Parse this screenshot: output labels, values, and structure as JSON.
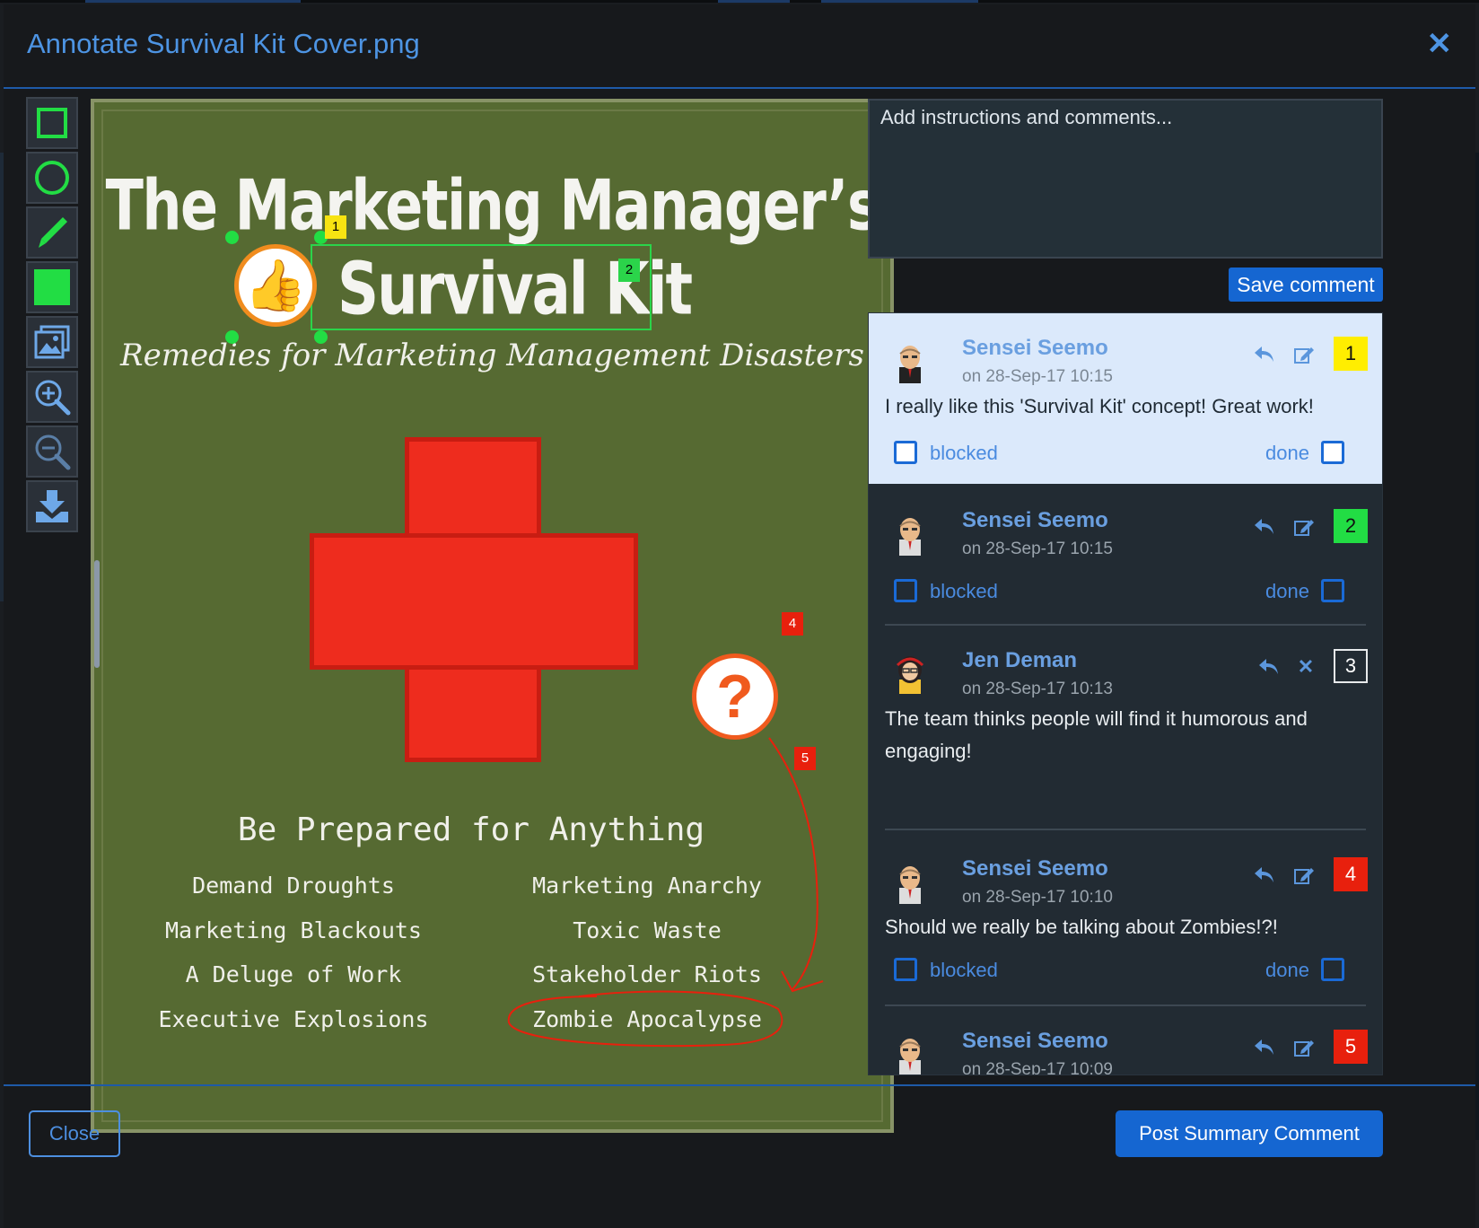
{
  "dialog": {
    "title": "Annotate Survival Kit Cover.png",
    "accent_color": "#4d94e3"
  },
  "toolbar": {
    "tools": [
      "rectangle-tool",
      "circle-tool",
      "pen-tool",
      "fill-color-tool",
      "image-tool",
      "zoom-in-tool",
      "zoom-out-tool",
      "download-tool"
    ],
    "active_color": "#22dd44"
  },
  "cover": {
    "title_line1": "The Marketing Manager’s",
    "title_line2": "Survival Kit",
    "subtitle": "Remedies for Marketing Management Disasters",
    "tagline": "Be Prepared for Anything",
    "disasters_left": [
      "Demand Droughts",
      "Marketing Blackouts",
      "A Deluge of Work",
      "Executive Explosions"
    ],
    "disasters_right": [
      "Marketing Anarchy",
      "Toxic Waste",
      "Stakeholder Riots",
      "Zombie Apocalypse"
    ],
    "background_color": "#566a32",
    "cross_color": "#ee2c1e"
  },
  "annotations": {
    "markers": [
      "1",
      "2",
      "4",
      "5"
    ],
    "marker_colors": {
      "1": "#f7e312",
      "2": "#2bd44a",
      "4": "#e8200d",
      "5": "#e8200d"
    }
  },
  "comment_form": {
    "placeholder": "Add instructions and comments...",
    "save_label": "Save comment"
  },
  "comments": [
    {
      "author": "Sensei Seemo",
      "date": "on 28-Sep-17 10:15",
      "text": "I really like this 'Survival Kit' concept! Great work!",
      "number": "1",
      "badge_color": "#ffee00",
      "blocked_label": "blocked",
      "done_label": "done"
    },
    {
      "author": "Sensei Seemo",
      "date": "on 28-Sep-17 10:15",
      "text": "",
      "number": "2",
      "badge_color": "#22dd44",
      "blocked_label": "blocked",
      "done_label": "done"
    },
    {
      "author": "Jen Deman",
      "date": "on 28-Sep-17 10:13",
      "text": "The team thinks people will find it humorous and engaging!",
      "number": "3",
      "badge_color": "#ffffff"
    },
    {
      "author": "Sensei Seemo",
      "date": "on 28-Sep-17 10:10",
      "text": "Should we really be talking about Zombies!?!",
      "number": "4",
      "badge_color": "#e8200d",
      "blocked_label": "blocked",
      "done_label": "done"
    },
    {
      "author": "Sensei Seemo",
      "date": "on 28-Sep-17 10:09",
      "text": "",
      "number": "5",
      "badge_color": "#e8200d"
    }
  ],
  "footer": {
    "close_label": "Close",
    "post_label": "Post Summary Comment"
  }
}
